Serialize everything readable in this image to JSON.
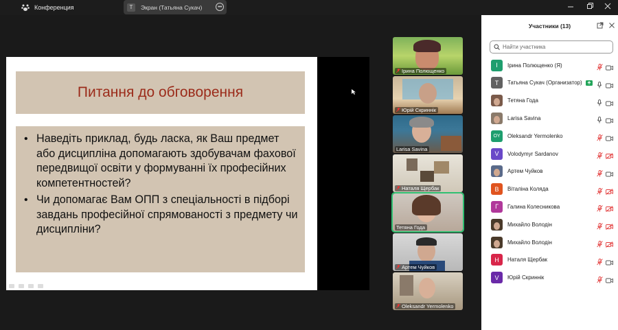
{
  "titlebar": {
    "app_name": "Конференция",
    "share_pill_letter": "T",
    "share_pill_text": "Экран (Татьяна Сукач)"
  },
  "slide": {
    "title": "Питання до обговорення",
    "bullets": [
      "Наведіть приклад, будь ласка, як Ваш предмет або дисципліна допомагають здобувачам фахової передвищої освіти у формуванні їх професійних компетентностей?",
      "Чи допомагає Вам ОПП з спеціальності в підборі завдань професійної спрямованості з предмету чи дисципліни?"
    ]
  },
  "videos": [
    {
      "name": "Ірина Полющенко"
    },
    {
      "name": "Юрій Скриннік"
    },
    {
      "name": "Larisa Savina"
    },
    {
      "name": "Наталя Щербак"
    },
    {
      "name": "Тетяна Года"
    },
    {
      "name": "Артем Чуйков"
    },
    {
      "name": "Oleksandr Yermolenko"
    }
  ],
  "panel": {
    "title": "Участники (13)",
    "search_placeholder": "Найти участника",
    "participants": [
      {
        "letter": "І",
        "name": "Ірина Полющенко (Я)",
        "color": "#1e9e6e",
        "mic": "off",
        "cam": "on",
        "photo": false
      },
      {
        "letter": "T",
        "name": "Татьяна Сукач (Организатор)",
        "color": "#616161",
        "mic": "on",
        "cam": "on",
        "share": true,
        "photo": false
      },
      {
        "letter": "",
        "name": "Тетяна Года",
        "color": "#7a5a4a",
        "mic": "on",
        "cam": "on",
        "photo": true
      },
      {
        "letter": "",
        "name": "Larisa Savina",
        "color": "#8a7a6a",
        "mic": "on",
        "cam": "on",
        "photo": true
      },
      {
        "letter": "OY",
        "name": "Oleksandr Yermolenko",
        "color": "#1e9e6e",
        "mic": "off",
        "cam": "on",
        "photo": false
      },
      {
        "letter": "V",
        "name": "Volodymyr Sardanov",
        "color": "#6a48c8",
        "mic": "off",
        "cam": "off",
        "photo": false
      },
      {
        "letter": "",
        "name": "Артем Чуйков",
        "color": "#5a6a8a",
        "mic": "off",
        "cam": "on",
        "photo": true
      },
      {
        "letter": "В",
        "name": "Віталіна Коляда",
        "color": "#e0541f",
        "mic": "off",
        "cam": "off",
        "photo": false
      },
      {
        "letter": "Г",
        "name": "Галина Колесникова",
        "color": "#b0389a",
        "mic": "off",
        "cam": "off",
        "photo": false
      },
      {
        "letter": "",
        "name": "Михайло Володін",
        "color": "#4a3a2a",
        "mic": "off",
        "cam": "off",
        "photo": true
      },
      {
        "letter": "",
        "name": "Михайло Володін",
        "color": "#4a3a2a",
        "mic": "off",
        "cam": "off",
        "photo": true
      },
      {
        "letter": "Н",
        "name": "Наталя Щербак",
        "color": "#d8264a",
        "mic": "off",
        "cam": "on",
        "photo": false
      },
      {
        "letter": "V",
        "name": "Юрій Скриннік",
        "color": "#6a2aa8",
        "mic": "off",
        "cam": "on",
        "photo": false
      }
    ]
  }
}
